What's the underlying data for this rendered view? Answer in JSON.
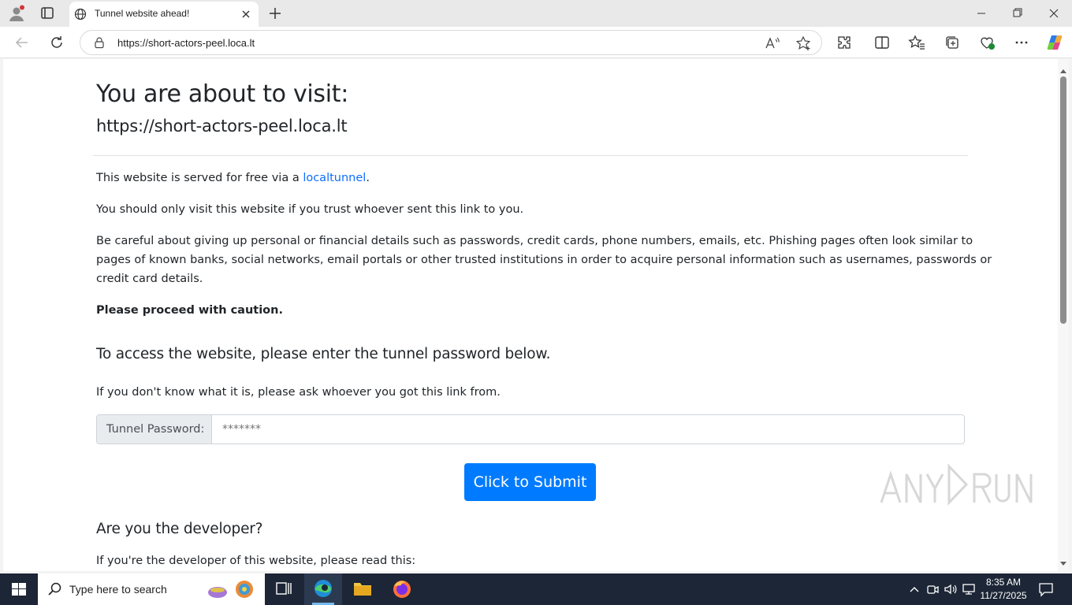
{
  "browser": {
    "tab_title": "Tunnel website ahead!",
    "url": "https://short-actors-peel.loca.lt"
  },
  "page": {
    "heading": "You are about to visit:",
    "visit_url": "https://short-actors-peel.loca.lt",
    "p1_before": "This website is served for free via a ",
    "p1_link": "localtunnel",
    "p1_after": ".",
    "p2": "You should only visit this website if you trust whoever sent this link to you.",
    "p3_lines": [
      "Be careful about giving up personal or financial details such as passwords, credit cards, phone numbers, emails, etc. Phishing pages often look similar to",
      "pages of known banks, social networks, email portals or other trusted institutions in order to acquire personal information such as usernames, passwords or",
      "credit card details."
    ],
    "caution": "Please proceed with caution.",
    "access_heading": "To access the website, please enter the tunnel password below.",
    "access_hint": "If you don't know what it is, please ask whoever you got this link from.",
    "password_label": "Tunnel Password:",
    "password_placeholder": "*******",
    "submit_label": "Click to Submit",
    "developer_heading": "Are you the developer?",
    "developer_text": "If you're the developer of this website, please read this:"
  },
  "taskbar": {
    "search_placeholder": "Type here to search",
    "time": "8:35 AM",
    "date": "11/27/2025"
  },
  "colors": {
    "link": "#0d6efd",
    "submit": "#007bff",
    "taskbar": "#1c2636"
  }
}
